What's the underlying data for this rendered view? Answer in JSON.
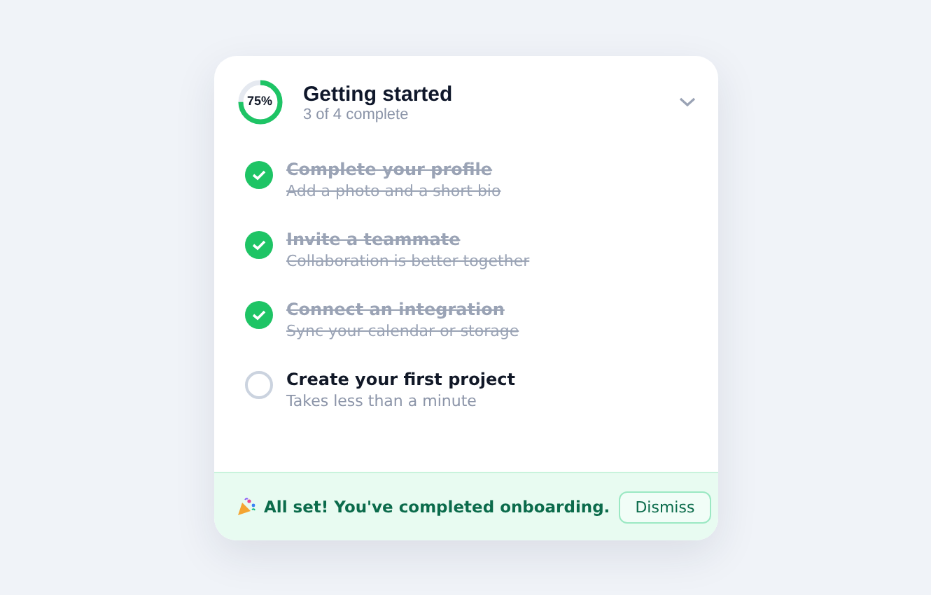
{
  "header": {
    "progress_label": "75%",
    "title": "Getting started",
    "subtitle": "3 of 4 complete",
    "expanded": true
  },
  "tasks": [
    {
      "title": "Complete your profile",
      "description": "Add a photo and a short bio",
      "checked": true
    },
    {
      "title": "Invite a teammate",
      "description": "Collaboration is better together",
      "checked": true
    },
    {
      "title": "Connect an integration",
      "description": "Sync your calendar or storage",
      "checked": true
    },
    {
      "title": "Create your first project",
      "description": "Takes less than a minute",
      "checked": false
    }
  ],
  "footer": {
    "message": "All set! You've completed onboarding.",
    "button": "Dismiss"
  }
}
